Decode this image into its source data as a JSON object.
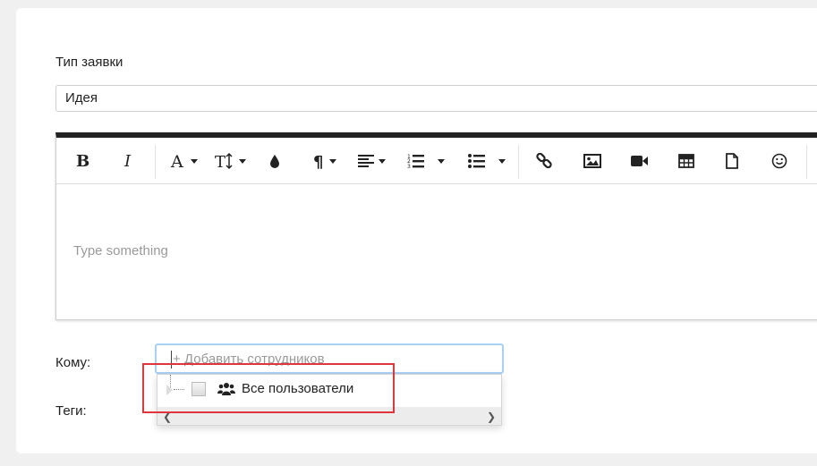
{
  "form": {
    "request_type_label": "Тип заявки",
    "request_type_value": "Идея",
    "to_label": "Кому:",
    "tags_label": "Теги:"
  },
  "editor": {
    "placeholder": "Type something",
    "toolbar": [
      "bold-icon",
      "italic-icon",
      "font-color-icon",
      "font-size-icon",
      "ink-drop-icon",
      "paragraph-icon",
      "align-icon",
      "ordered-list-icon",
      "unordered-list-icon",
      "link-icon",
      "image-icon",
      "video-icon",
      "table-icon",
      "file-icon",
      "emoji-icon"
    ]
  },
  "recipients": {
    "placeholder": "+ Добавить сотрудников",
    "tree": [
      {
        "label": "Все пользователи",
        "icon": "users-icon",
        "checked": false
      }
    ]
  },
  "colors": {
    "accent_border": "#a9d0f5",
    "highlight": "#e2343c",
    "toolbar_top": "#222222"
  }
}
